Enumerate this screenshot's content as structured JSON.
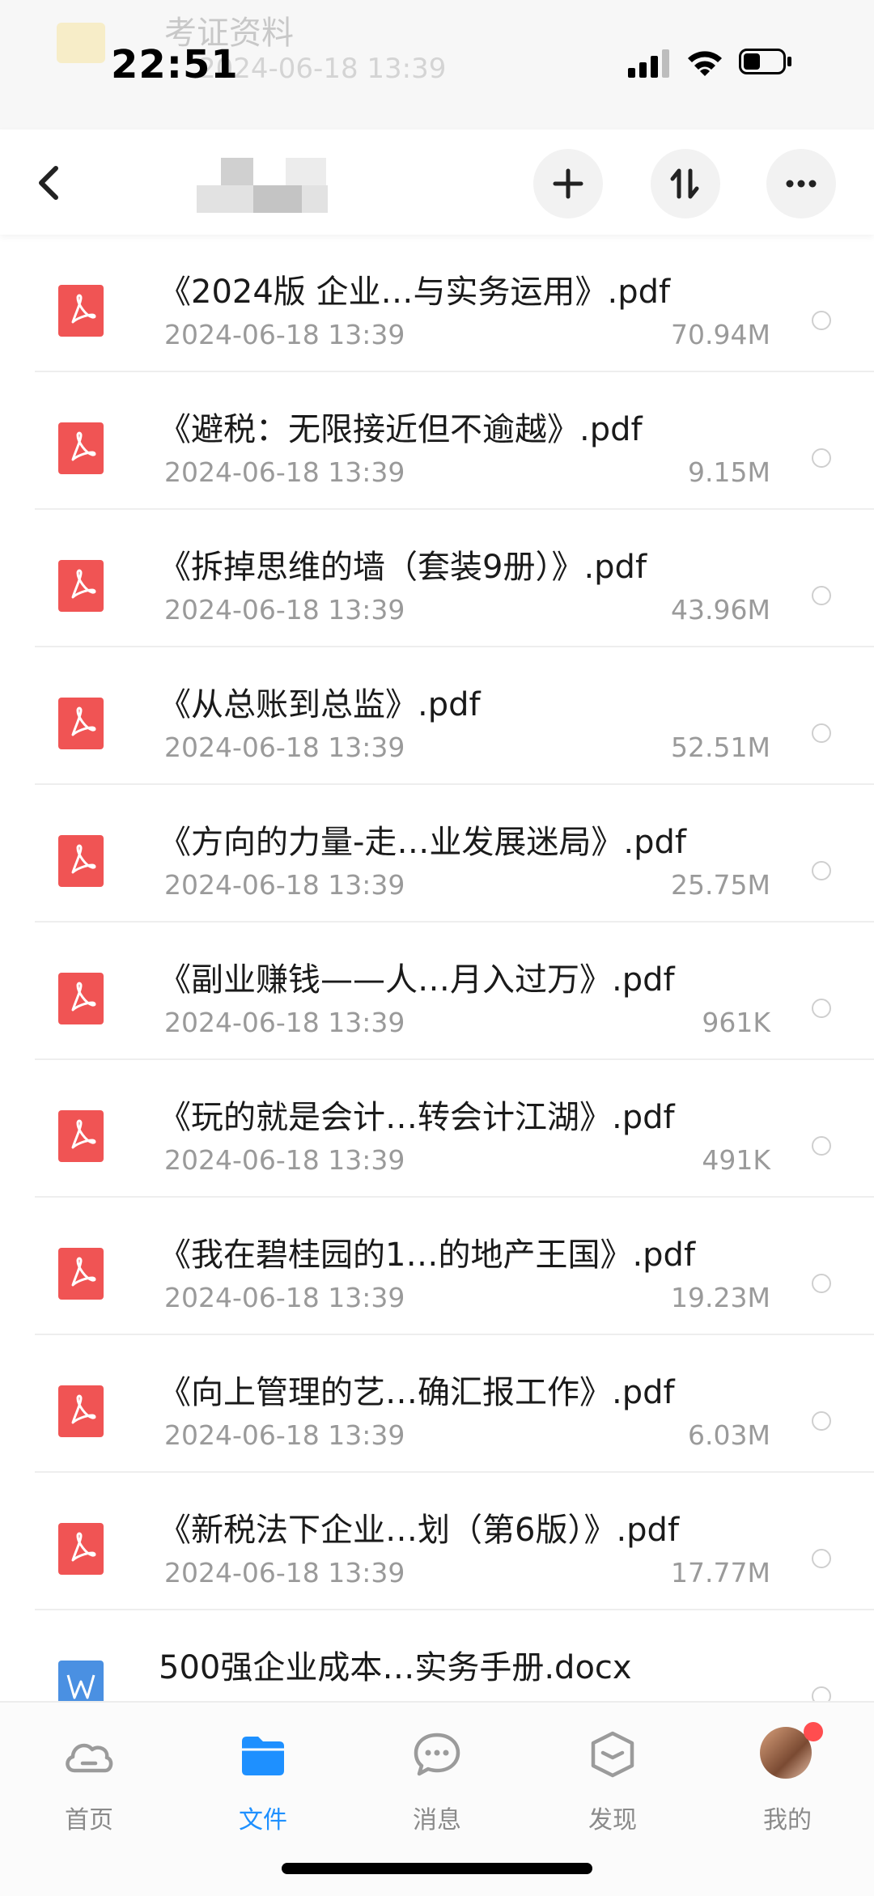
{
  "status_bar": {
    "time": "22:51"
  },
  "background_folder": {
    "name": "考证资料",
    "date": "2024-06-18 13:39"
  },
  "header": {
    "back_icon": "chevron-left-icon",
    "add_icon": "plus-icon",
    "sort_icon": "sort-icon",
    "more_icon": "more-icon"
  },
  "files": [
    {
      "name": "《2024版 企业…与实务运用》.pdf",
      "date": "2024-06-18 13:39",
      "size": "70.94M",
      "type": "pdf"
    },
    {
      "name": "《避税：无限接近但不逾越》.pdf",
      "date": "2024-06-18 13:39",
      "size": "9.15M",
      "type": "pdf"
    },
    {
      "name": "《拆掉思维的墙（套装9册）》.pdf",
      "date": "2024-06-18 13:39",
      "size": "43.96M",
      "type": "pdf"
    },
    {
      "name": "《从总账到总监》.pdf",
      "date": "2024-06-18 13:39",
      "size": "52.51M",
      "type": "pdf"
    },
    {
      "name": "《方向的力量-走…业发展迷局》.pdf",
      "date": "2024-06-18 13:39",
      "size": "25.75M",
      "type": "pdf"
    },
    {
      "name": "《副业赚钱——人…月入过万》.pdf",
      "date": "2024-06-18 13:39",
      "size": "961K",
      "type": "pdf"
    },
    {
      "name": "《玩的就是会计…转会计江湖》.pdf",
      "date": "2024-06-18 13:39",
      "size": "491K",
      "type": "pdf"
    },
    {
      "name": "《我在碧桂园的1…的地产王国》.pdf",
      "date": "2024-06-18 13:39",
      "size": "19.23M",
      "type": "pdf"
    },
    {
      "name": "《向上管理的艺…确汇报工作》.pdf",
      "date": "2024-06-18 13:39",
      "size": "6.03M",
      "type": "pdf"
    },
    {
      "name": "《新税法下企业…划（第6版）》.pdf",
      "date": "2024-06-18 13:39",
      "size": "17.77M",
      "type": "pdf"
    },
    {
      "name": "500强企业成本…实务手册.docx",
      "date": "",
      "size": "",
      "type": "docx"
    }
  ],
  "bottom_nav": [
    {
      "label": "首页",
      "icon": "cloud-icon",
      "active": false
    },
    {
      "label": "文件",
      "icon": "folder-icon",
      "active": true
    },
    {
      "label": "消息",
      "icon": "chat-bubble-icon",
      "active": false
    },
    {
      "label": "发现",
      "icon": "discover-icon",
      "active": false
    },
    {
      "label": "我的",
      "icon": "avatar",
      "active": false
    }
  ],
  "colors": {
    "accent": "#1e90ff",
    "pdf": "#f05454",
    "docx": "#4a90e2",
    "badge": "#ff4d4f"
  }
}
